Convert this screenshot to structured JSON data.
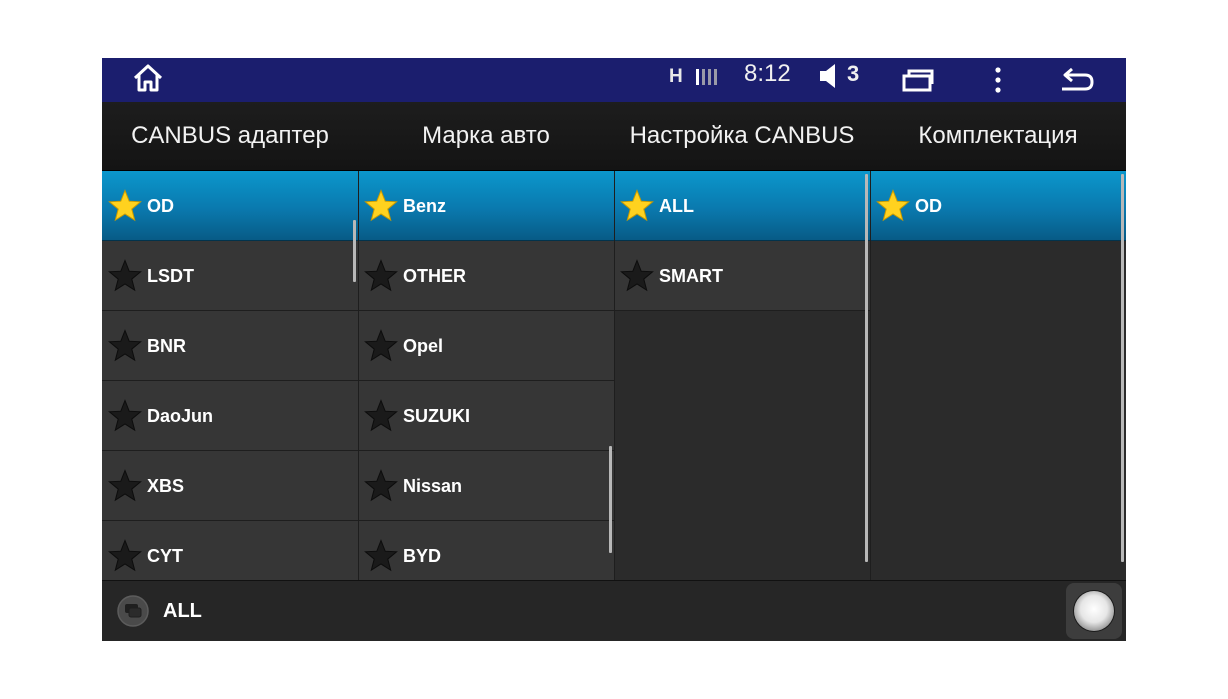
{
  "status_bar": {
    "signal_type": "H",
    "time": "8:12",
    "volume": "3",
    "icons": [
      "home-icon",
      "signal-bars-icon",
      "volume-icon",
      "recent-apps-icon",
      "more-vert-icon",
      "back-icon"
    ]
  },
  "tabs": [
    "CANBUS адаптер",
    "Марка авто",
    "Настройка CANBUS",
    "Комплектация"
  ],
  "columns": [
    {
      "items": [
        "OD",
        "LSDT",
        "BNR",
        "DaoJun",
        "XBS",
        "CYT"
      ],
      "selected": "OD"
    },
    {
      "items": [
        "Benz",
        "OTHER",
        "Opel",
        "SUZUKI",
        "Nissan",
        "BYD"
      ],
      "selected": "Benz"
    },
    {
      "items": [
        "ALL",
        "SMART"
      ],
      "selected": "ALL"
    },
    {
      "items": [
        "OD"
      ],
      "selected": "OD"
    }
  ],
  "footer": {
    "label": "ALL"
  },
  "colors": {
    "status_bar_bg": "#1b1e6e",
    "selected_row": "#0a79ae",
    "row_bg": "#363636",
    "star_selected": "#ffd21f",
    "star_unselected": "#1a1a1a"
  }
}
